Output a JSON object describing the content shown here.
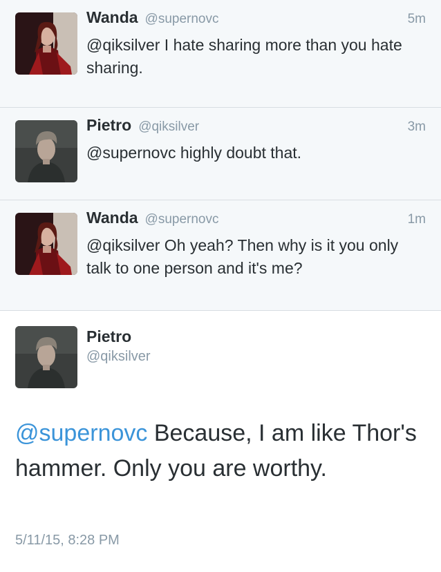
{
  "tweets": [
    {
      "name": "Wanda",
      "handle": "@supernovc",
      "time": "5m",
      "text": "@qiksilver I hate sharing more than you hate sharing."
    },
    {
      "name": "Pietro",
      "handle": "@qiksilver",
      "time": "3m",
      "text": "@supernovc highly doubt that."
    },
    {
      "name": "Wanda",
      "handle": "@supernovc",
      "time": "1m",
      "text": "@qiksilver Oh yeah? Then why is it you only talk to one person and it's me?"
    }
  ],
  "detail": {
    "name": "Pietro",
    "handle": "@qiksilver",
    "mention": "@supernovc",
    "text": " Because, I am like Thor's hammer. Only you are worthy.",
    "timestamp": "5/11/15, 8:28 PM"
  },
  "colors": {
    "background_gray": "#f5f8fa",
    "mention_blue": "#3b94d9",
    "meta_gray": "#8899a6",
    "text_dark": "#292f33"
  }
}
